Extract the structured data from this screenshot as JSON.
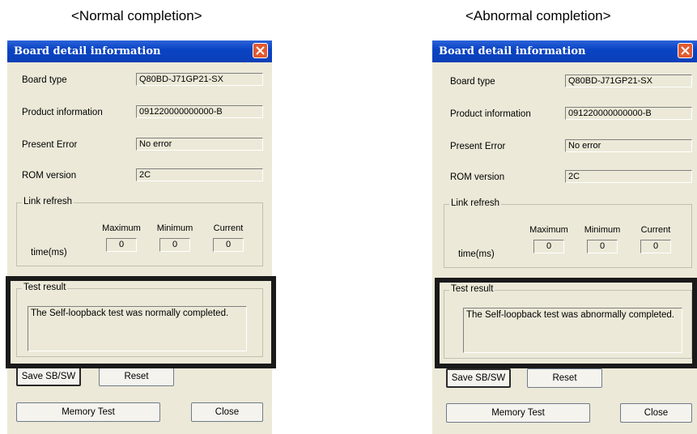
{
  "headings": {
    "normal": "<Normal completion>",
    "abnormal": "<Abnormal completion>"
  },
  "dialogs": [
    {
      "title": "Board detail information",
      "board_type_label": "Board type",
      "board_type_value": "Q80BD-J71GP21-SX",
      "product_info_label": "Product information",
      "product_info_value": "091220000000000-B",
      "present_error_label": "Present Error",
      "present_error_value": "No error",
      "rom_version_label": "ROM version",
      "rom_version_value": "2C",
      "link_refresh_label": "Link refresh",
      "col_max": "Maximum",
      "col_min": "Minimum",
      "col_cur": "Current",
      "time_label": "time(ms)",
      "max_value": "0",
      "min_value": "0",
      "cur_value": "0",
      "test_result_label": "Test result",
      "test_result_text": "The Self-loopback test was normally completed.",
      "save_label": "Save SB/SW",
      "reset_label": "Reset",
      "memory_test_label": "Memory Test",
      "close_label": "Close"
    },
    {
      "title": "Board detail information",
      "board_type_label": "Board type",
      "board_type_value": "Q80BD-J71GP21-SX",
      "product_info_label": "Product information",
      "product_info_value": "091220000000000-B",
      "present_error_label": "Present Error",
      "present_error_value": "No error",
      "rom_version_label": "ROM version",
      "rom_version_value": "2C",
      "link_refresh_label": "Link refresh",
      "col_max": "Maximum",
      "col_min": "Minimum",
      "col_cur": "Current",
      "time_label": "time(ms)",
      "max_value": "0",
      "min_value": "0",
      "cur_value": "0",
      "test_result_label": "Test result",
      "test_result_text": "The Self-loopback test was abnormally completed.",
      "save_label": "Save SB/SW",
      "reset_label": "Reset",
      "memory_test_label": "Memory Test",
      "close_label": "Close"
    }
  ],
  "colors": {
    "titlebar": "#0a44c4",
    "dialog_bg": "#ece9d8",
    "close_button": "#e25a30",
    "highlight_frame": "#1a1a1a"
  },
  "icons": {
    "close": "close-x-icon"
  }
}
